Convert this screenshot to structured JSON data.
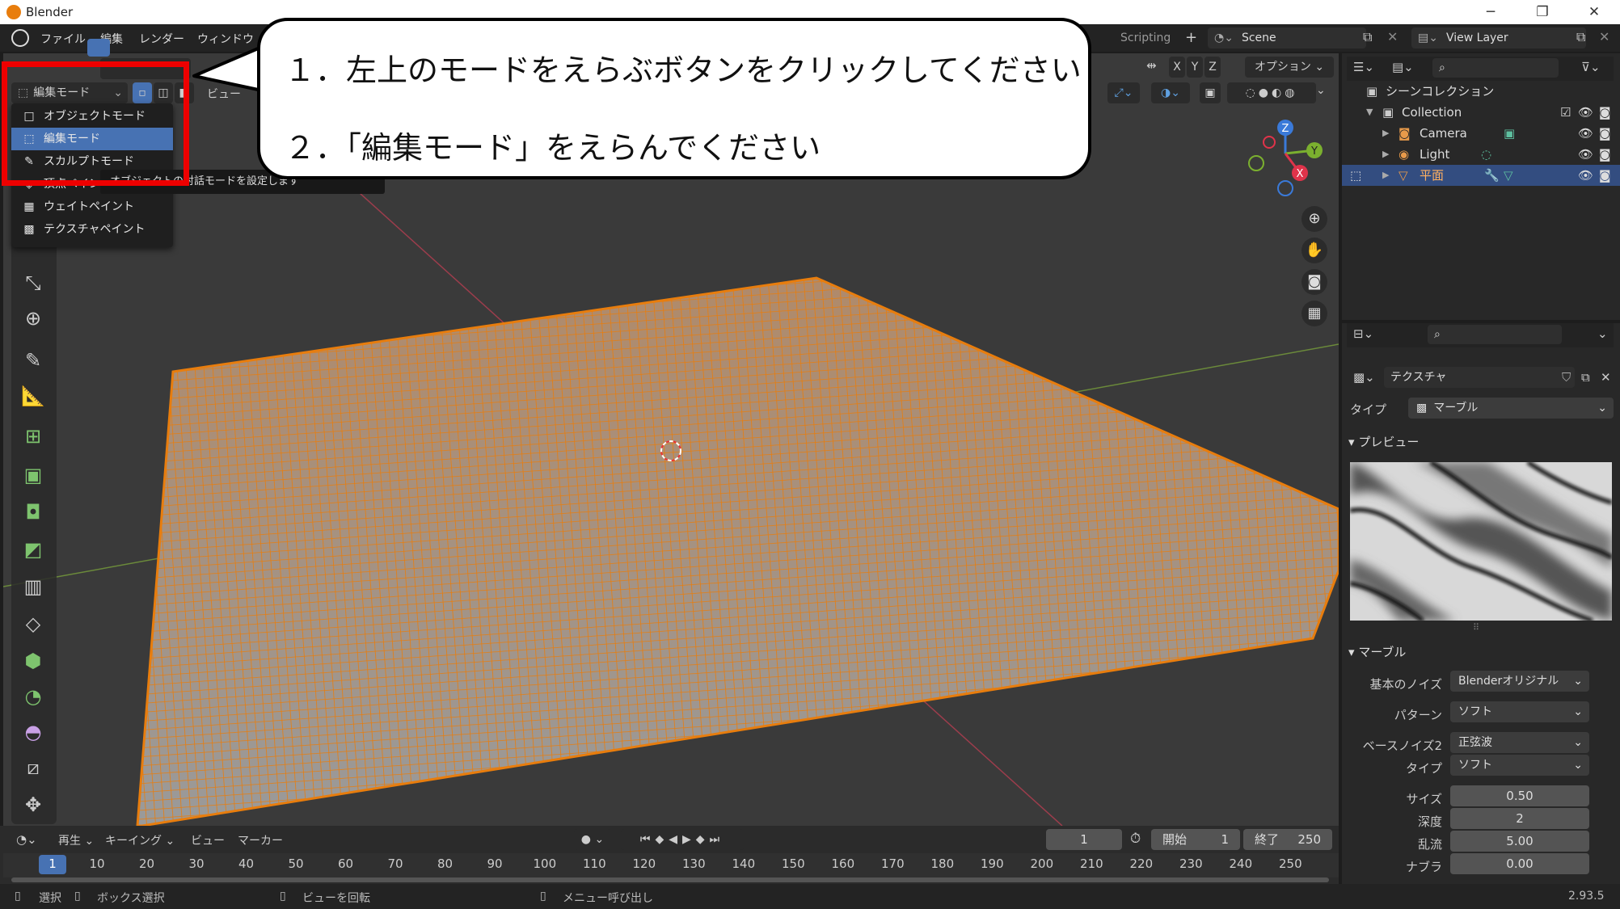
{
  "window": {
    "title": "Blender",
    "minimize": "─",
    "maximize": "❐",
    "close": "✕"
  },
  "topbar": {
    "menus": [
      "ファイル",
      "編集",
      "レンダー",
      "ウィンドウ"
    ],
    "workspace_tab": "Scripting",
    "add_tab": "+",
    "scene": "Scene",
    "view_layer": "View Layer"
  },
  "viewport_header": {
    "mode": "編集モード",
    "view_menu": "ビュー",
    "axes": [
      "X",
      "Y",
      "Z"
    ],
    "options": "オプション"
  },
  "mode_menu": {
    "items": [
      {
        "label": "オブジェクトモード",
        "icon": "□",
        "selected": false
      },
      {
        "label": "編集モード",
        "icon": "⬚",
        "selected": true
      },
      {
        "label": "スカルプトモード",
        "icon": "✎",
        "selected": false
      },
      {
        "label": "頂点ペイント",
        "icon": "◈",
        "selected": false
      },
      {
        "label": "ウェイトペイント",
        "icon": "▦",
        "selected": false
      },
      {
        "label": "テクスチャペイント",
        "icon": "▩",
        "selected": false
      }
    ],
    "tooltip": "オブジェクトの対話モードを設定します"
  },
  "callout": {
    "line1": "１．左上のモードをえらぶボタンをクリックしてください",
    "line2": "２．「編集モード」をえらんでください"
  },
  "gizmo": {
    "z": "Z",
    "y": "Y",
    "x": "X"
  },
  "outliner": {
    "root": "シーンコレクション",
    "items": [
      {
        "label": "Collection",
        "indent": 1
      },
      {
        "label": "Camera",
        "indent": 2
      },
      {
        "label": "Light",
        "indent": 2
      },
      {
        "label": "平面",
        "indent": 2,
        "selected": true
      }
    ]
  },
  "properties": {
    "texture_name": "テクスチャ",
    "type_label": "タイプ",
    "type_value": "マーブル",
    "preview_header": "プレビュー",
    "marble_header": "マーブル",
    "rows": [
      {
        "label": "基本のノイズ",
        "value": "Blenderオリジナル"
      },
      {
        "label": "パターン",
        "value": "ソフト"
      },
      {
        "label": "ベースノイズ2",
        "value": "正弦波"
      },
      {
        "label": "タイプ",
        "value": "ソフト"
      }
    ],
    "numbers": [
      {
        "label": "サイズ",
        "value": "0.50"
      },
      {
        "label": "深度",
        "value": "2"
      },
      {
        "label": "乱流",
        "value": "5.00"
      },
      {
        "label": "ナブラ",
        "value": "0.00"
      }
    ]
  },
  "timeline": {
    "menus": [
      "再生",
      "キーイング",
      "ビュー",
      "マーカー"
    ],
    "current_frame": "1",
    "start_label": "開始",
    "start": "1",
    "end_label": "終了",
    "end": "250",
    "ticks": [
      "1",
      "10",
      "20",
      "30",
      "40",
      "50",
      "60",
      "70",
      "80",
      "90",
      "100",
      "110",
      "120",
      "130",
      "140",
      "150",
      "160",
      "170",
      "180",
      "190",
      "200",
      "210",
      "220",
      "230",
      "240",
      "250"
    ]
  },
  "statusbar": {
    "select": "選択",
    "box_select": "ボックス選択",
    "rotate": "ビューを回転",
    "menu": "メニュー呼び出し",
    "version": "2.93.5"
  },
  "colors": {
    "accent": "#e87d0d",
    "selected": "#4772b3",
    "highlight": "#ee0000"
  }
}
